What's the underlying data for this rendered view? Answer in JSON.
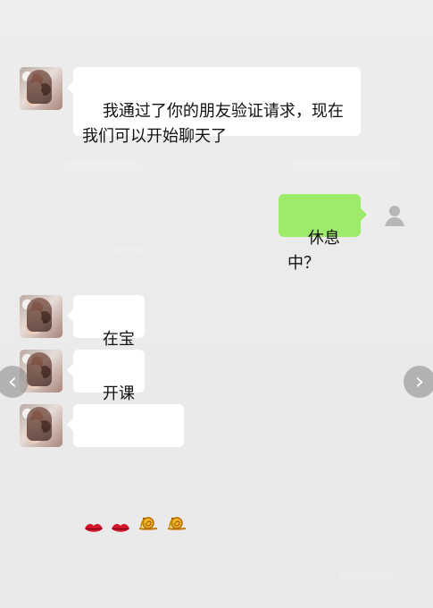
{
  "chat": {
    "messages": [
      {
        "id": "m1",
        "side": "left",
        "text": "我通过了你的朋友验证请求，现在\n我们可以开始聊天了"
      },
      {
        "id": "m2",
        "side": "right",
        "text": "休息中？"
      },
      {
        "id": "m3",
        "side": "left",
        "text": "在宝贝"
      },
      {
        "id": "m4",
        "side": "left",
        "text": "开课了"
      },
      {
        "id": "m5",
        "side": "left",
        "emojis": [
          "lips",
          "lips",
          "snail",
          "snail"
        ]
      }
    ]
  },
  "nav": {
    "prev_symbol": "‹",
    "next_symbol": "›"
  },
  "colors": {
    "background": "#ececec",
    "incoming_bubble": "#ffffff",
    "outgoing_bubble": "#9eea6a",
    "nav_button": "#6e6e6e"
  }
}
